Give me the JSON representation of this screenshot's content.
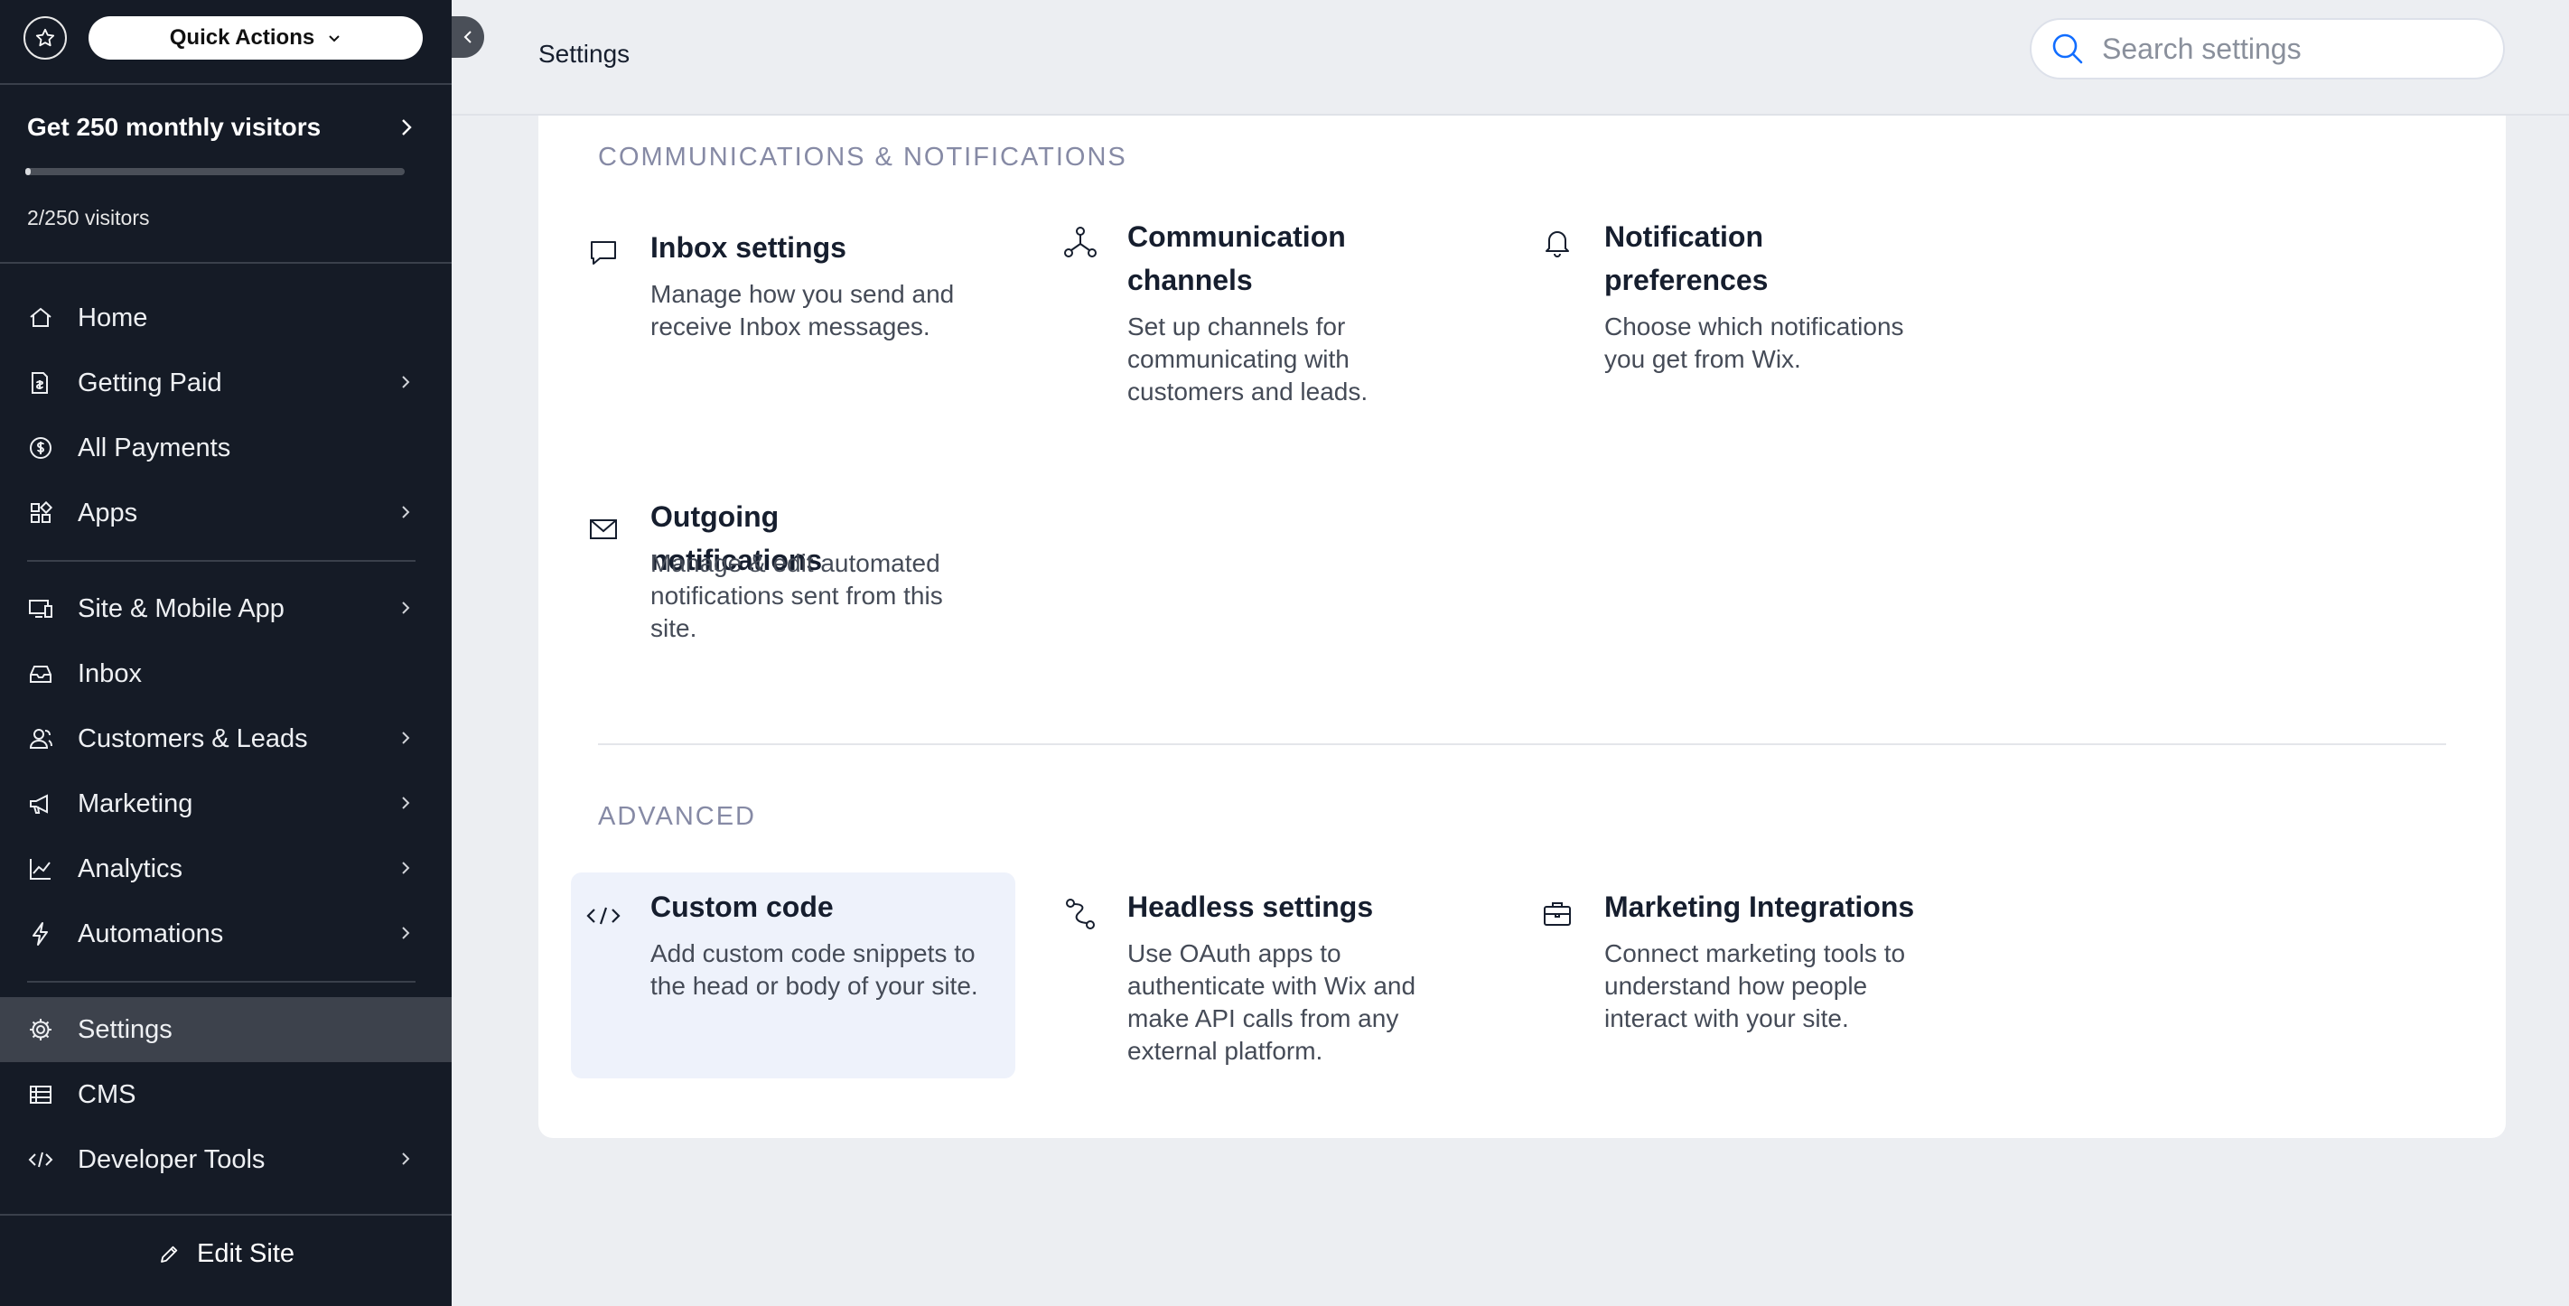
{
  "sidebar": {
    "quick_actions_label": "Quick Actions",
    "promo": {
      "title": "Get 250 monthly visitors",
      "count": "2/250 visitors",
      "progress_fraction": 0.008
    },
    "nav": [
      {
        "label": "Home",
        "icon": "home-icon",
        "chevron": false,
        "active": false
      },
      {
        "label": "Getting Paid",
        "icon": "getting-paid-icon",
        "chevron": true,
        "active": false
      },
      {
        "label": "All Payments",
        "icon": "dollar-circle-icon",
        "chevron": false,
        "active": false
      },
      {
        "label": "Apps",
        "icon": "apps-icon",
        "chevron": true,
        "active": false
      },
      {
        "label": "Site & Mobile App",
        "icon": "devices-icon",
        "chevron": true,
        "active": false
      },
      {
        "label": "Inbox",
        "icon": "inbox-icon",
        "chevron": false,
        "active": false
      },
      {
        "label": "Customers & Leads",
        "icon": "customers-icon",
        "chevron": true,
        "active": false
      },
      {
        "label": "Marketing",
        "icon": "megaphone-icon",
        "chevron": true,
        "active": false
      },
      {
        "label": "Analytics",
        "icon": "analytics-icon",
        "chevron": true,
        "active": false
      },
      {
        "label": "Automations",
        "icon": "lightning-icon",
        "chevron": true,
        "active": false
      },
      {
        "label": "Settings",
        "icon": "gear-icon",
        "chevron": false,
        "active": true
      },
      {
        "label": "CMS",
        "icon": "table-icon",
        "chevron": false,
        "active": false
      },
      {
        "label": "Developer Tools",
        "icon": "code-icon",
        "chevron": true,
        "active": false
      }
    ],
    "edit_site_label": "Edit Site"
  },
  "header": {
    "title": "Settings",
    "search_placeholder": "Search settings"
  },
  "sections": {
    "communications": {
      "label": "COMMUNICATIONS & NOTIFICATIONS",
      "tiles": [
        {
          "title": "Inbox settings",
          "description": "Manage how you send and receive Inbox messages.",
          "icon": "chat-bubble-icon"
        },
        {
          "title": "Communication channels",
          "description": "Set up channels for communicating with customers and leads.",
          "icon": "network-icon"
        },
        {
          "title": "Notification preferences",
          "description": "Choose which notifications you get from Wix.",
          "icon": "bell-icon"
        },
        {
          "title": "Outgoing notifications",
          "description": "Manage & edit automated notifications sent from this site.",
          "icon": "envelope-icon"
        }
      ]
    },
    "advanced": {
      "label": "ADVANCED",
      "tiles": [
        {
          "title": "Custom code",
          "description": "Add custom code snippets to the head or body of your site.",
          "icon": "code-icon"
        },
        {
          "title": "Headless settings",
          "description": "Use OAuth apps to authenticate with Wix and make API calls from any external platform.",
          "icon": "headless-icon"
        },
        {
          "title": "Marketing Integrations",
          "description": "Connect marketing tools to understand how people interact with your site.",
          "icon": "briefcase-icon"
        }
      ]
    }
  },
  "colors": {
    "sidebar_bg": "#151b26",
    "active_nav_bg": "#3d424c",
    "accent_blue": "#116dff",
    "highlight_tile_bg": "#eef2fb"
  }
}
